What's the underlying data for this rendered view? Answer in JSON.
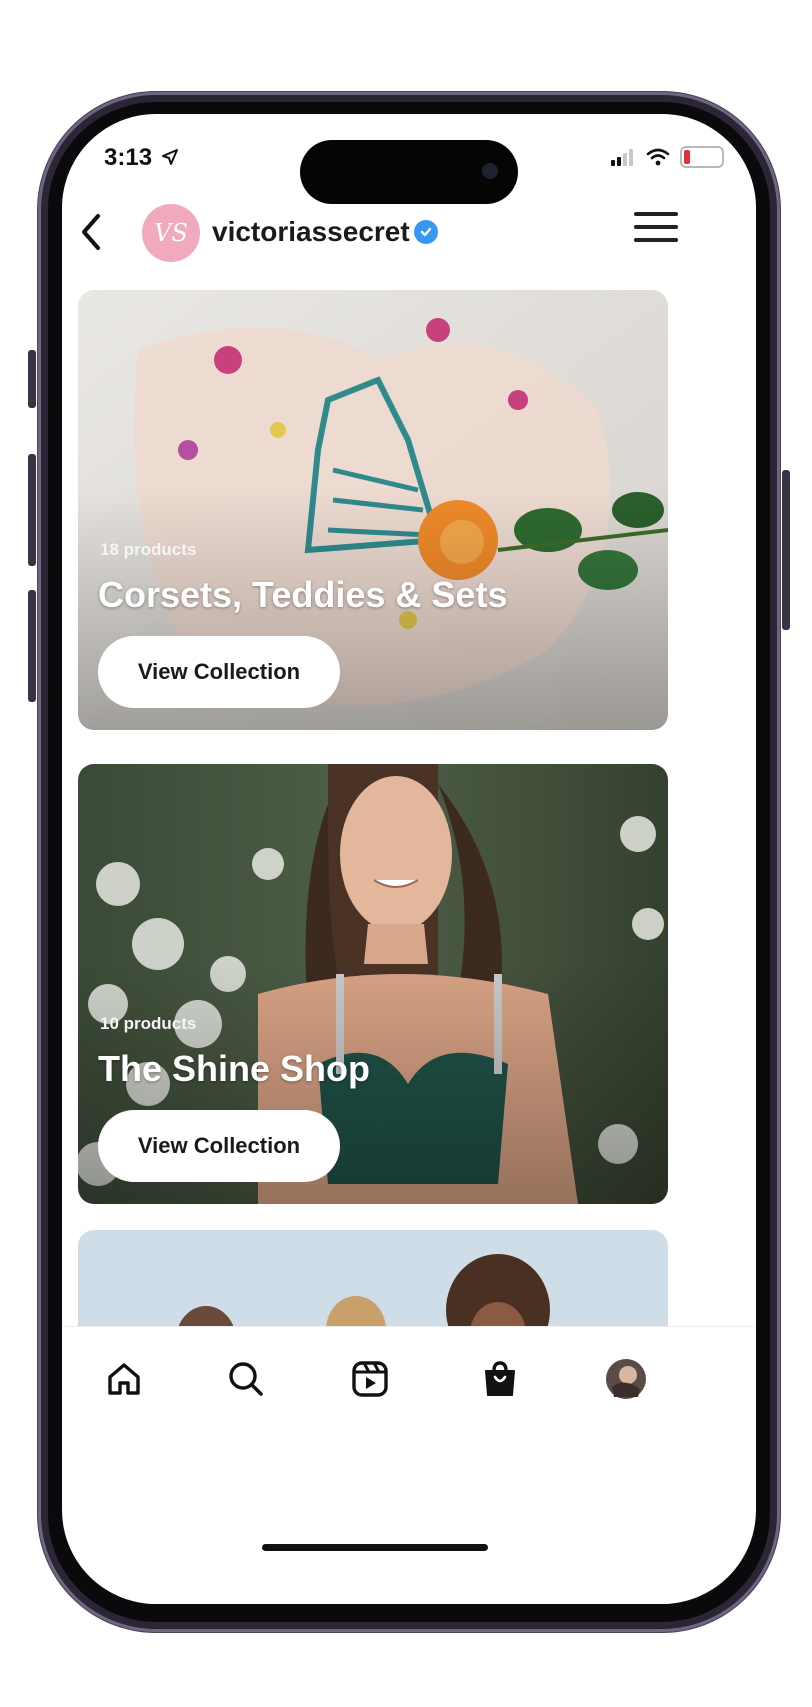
{
  "status_bar": {
    "time": "3:13"
  },
  "header": {
    "username": "victoriassecret",
    "avatar_monogram": "VS",
    "verified_color": "#3897f0"
  },
  "collections": [
    {
      "count_label": "18 products",
      "title": "Corsets, Teddies & Sets",
      "button_label": "View Collection"
    },
    {
      "count_label": "10 products",
      "title": "The Shine Shop",
      "button_label": "View Collection"
    }
  ],
  "bottom_nav": {
    "items": [
      "home-icon",
      "search-icon",
      "reels-icon",
      "shop-icon",
      "profile-avatar"
    ]
  },
  "colors": {
    "brand_pink": "#f0a9bd",
    "battery_low": "#e0303b"
  }
}
